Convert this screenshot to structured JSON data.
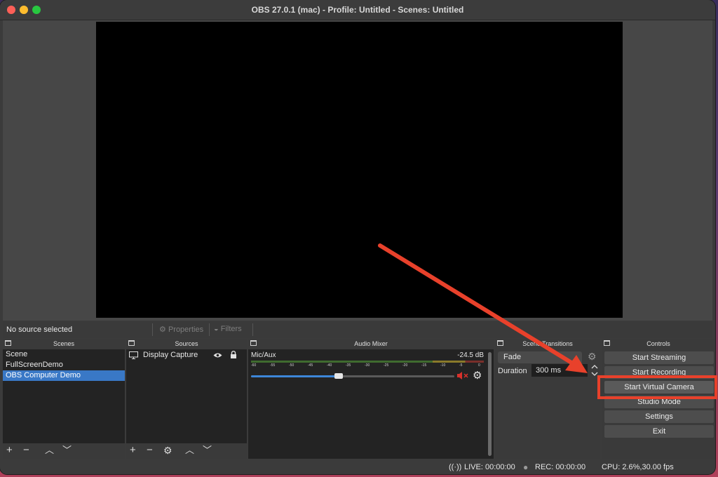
{
  "window": {
    "title": "OBS 27.0.1 (mac) - Profile: Untitled - Scenes: Untitled"
  },
  "source_toolbar": {
    "status": "No source selected",
    "properties_label": "Properties",
    "filters_label": "Filters"
  },
  "scenes": {
    "title": "Scenes",
    "items": [
      "Scene",
      "FullScreenDemo",
      "OBS Computer Demo"
    ],
    "selected_index": 2
  },
  "sources": {
    "title": "Sources",
    "items": [
      {
        "label": "Display Capture",
        "icon": "monitor-icon"
      }
    ]
  },
  "audio_mixer": {
    "title": "Audio Mixer",
    "channel_name": "Mic/Aux",
    "level": "-24.5 dB",
    "ticks": [
      "-60",
      "-55",
      "-50",
      "-45",
      "-40",
      "-35",
      "-30",
      "-25",
      "-20",
      "-15",
      "-10",
      "-5",
      "0"
    ],
    "volume_fraction": 0.43,
    "muted": true
  },
  "transitions": {
    "title": "Scene Transitions",
    "type": "Fade",
    "duration_label": "Duration",
    "duration_value": "300 ms"
  },
  "controls": {
    "title": "Controls",
    "start_streaming": "Start Streaming",
    "start_recording": "Start Recording",
    "start_virtual_camera": "Start Virtual Camera",
    "studio_mode": "Studio Mode",
    "settings": "Settings",
    "exit": "Exit"
  },
  "status": {
    "live": "LIVE: 00:00:00",
    "rec": "REC: 00:00:00",
    "cpu": "CPU: 2.6%,30.00 fps"
  },
  "colors": {
    "accent_selected": "#3978c6",
    "annotation": "#e8412b",
    "mute_red": "#d9312b"
  }
}
